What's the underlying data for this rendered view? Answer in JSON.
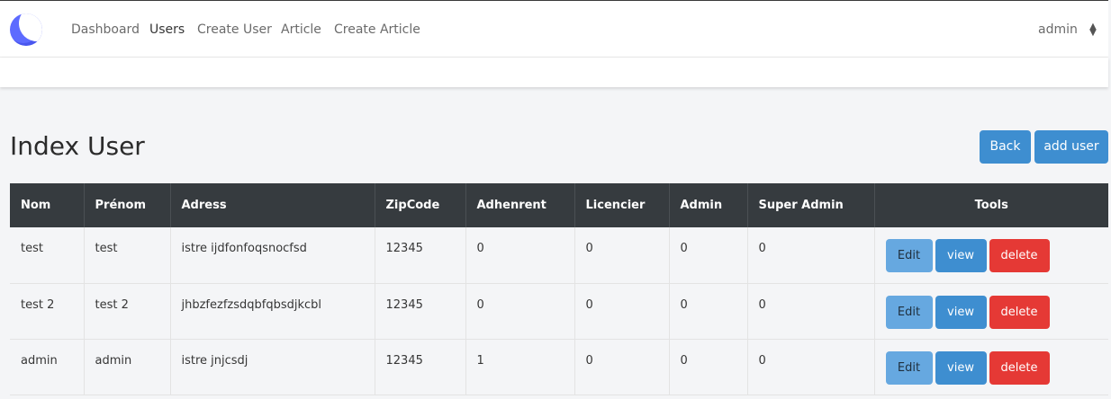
{
  "nav": {
    "items": [
      {
        "label": "Dashboard"
      },
      {
        "label": "Users"
      },
      {
        "label": "Create User"
      },
      {
        "label": "Article"
      },
      {
        "label": "Create Article"
      }
    ],
    "user": "admin"
  },
  "page": {
    "title": "Index User",
    "back_label": "Back",
    "add_label": "add user"
  },
  "table": {
    "headers": [
      "Nom",
      "Prénom",
      "Adress",
      "ZipCode",
      "Adhenrent",
      "Licencier",
      "Admin",
      "Super Admin",
      "Tools"
    ],
    "rows": [
      {
        "nom": "test",
        "prenom": "test",
        "adress": "istre ijdfonfoqsnocfsd",
        "zipcode": "12345",
        "adherent": "0",
        "licencier": "0",
        "admin": "0",
        "super_admin": "0"
      },
      {
        "nom": "test 2",
        "prenom": "test 2",
        "adress": "jhbzfezfzsdqbfqbsdjkcbl",
        "zipcode": "12345",
        "adherent": "0",
        "licencier": "0",
        "admin": "0",
        "super_admin": "0"
      },
      {
        "nom": "admin",
        "prenom": "admin",
        "adress": "istre jnjcsdj",
        "zipcode": "12345",
        "adherent": "1",
        "licencier": "0",
        "admin": "0",
        "super_admin": "0"
      }
    ],
    "actions": {
      "edit": "Edit",
      "view": "view",
      "delete": "delete"
    }
  }
}
